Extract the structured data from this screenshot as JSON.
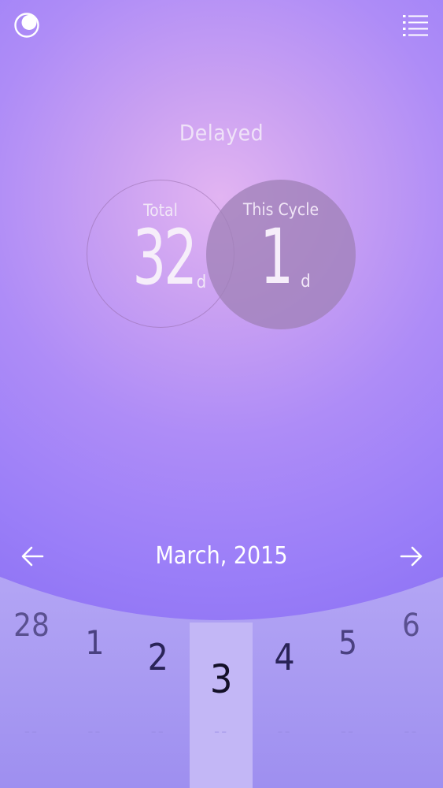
{
  "header": {
    "left_icon": "moon-icon",
    "right_icon": "menu-list-icon"
  },
  "status": {
    "text": "Delayed"
  },
  "summary": {
    "total": {
      "label": "Total",
      "value": "32",
      "unit": "d"
    },
    "this_cycle": {
      "label": "This Cycle",
      "value": "1",
      "unit": "d"
    }
  },
  "month_nav": {
    "label": "March, 2015",
    "prev_icon": "arrow-left-icon",
    "next_icon": "arrow-right-icon"
  },
  "days": [
    {
      "day": "28",
      "marker": "--"
    },
    {
      "day": "1",
      "marker": "--"
    },
    {
      "day": "2",
      "marker": "--"
    },
    {
      "day": "3",
      "marker": "--",
      "selected": true
    },
    {
      "day": "4",
      "marker": "--"
    },
    {
      "day": "5",
      "marker": "--"
    },
    {
      "day": "6",
      "marker": "--"
    }
  ],
  "colors": {
    "background_top": "#9a7ef8",
    "background_glow": "#e2b4f2",
    "strip": "#a99bf3",
    "selected_column": "#c4b8f6",
    "text_light": "#f6eefa"
  }
}
